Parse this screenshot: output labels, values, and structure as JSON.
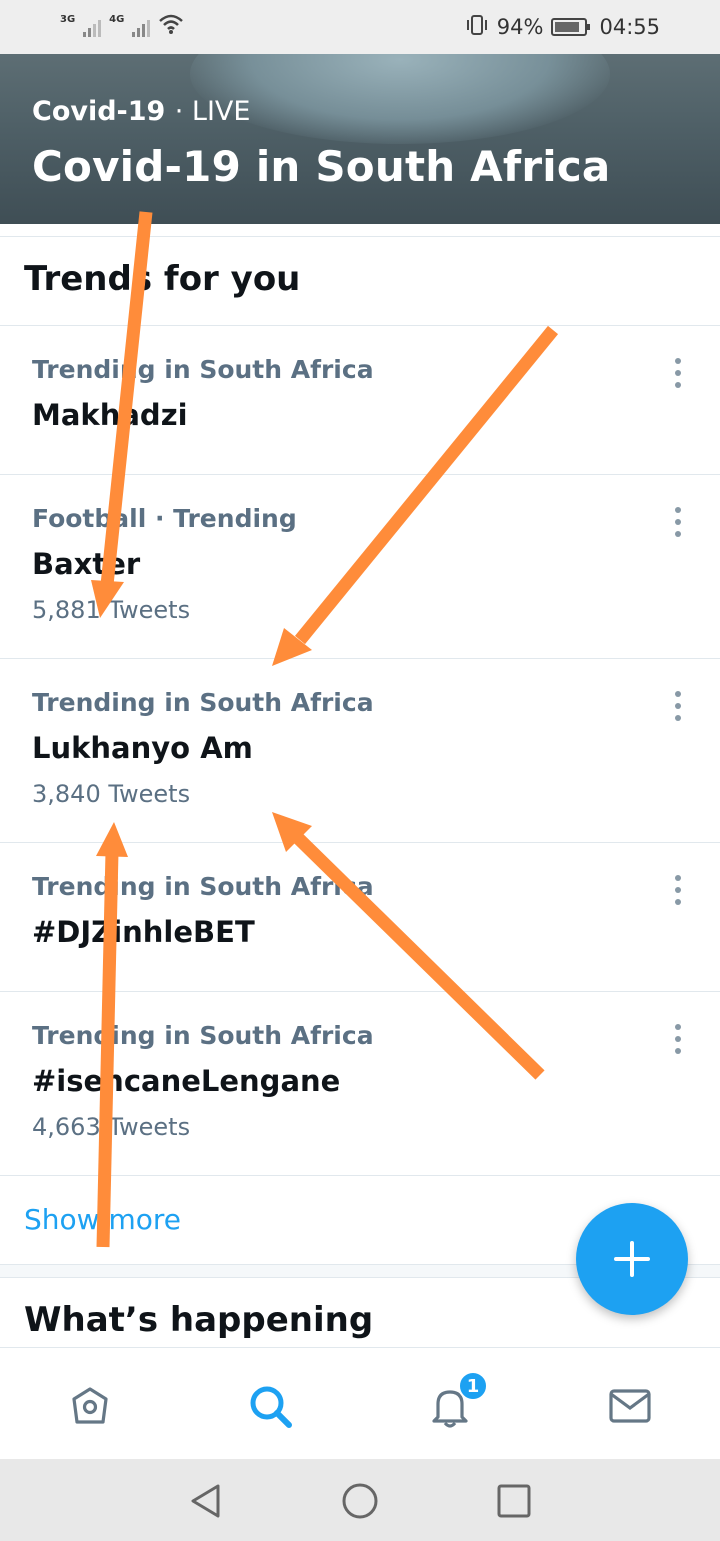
{
  "status_bar": {
    "net1": "3G",
    "net2": "4G",
    "battery": "94%",
    "time": "04:55"
  },
  "hero": {
    "category": "Covid-19",
    "live_label": "· LIVE",
    "title": "Covid-19 in South Africa"
  },
  "trends_header": "Trends for you",
  "trends": [
    {
      "context": "Trending in South Africa",
      "name": "Makhadzi",
      "count": ""
    },
    {
      "context": "Football · Trending",
      "name": "Baxter",
      "count": "5,881 Tweets"
    },
    {
      "context": "Trending in South Africa",
      "name": "Lukhanyo Am",
      "count": "3,840 Tweets"
    },
    {
      "context": "Trending in South Africa",
      "name": "#DJZinhleBET",
      "count": ""
    },
    {
      "context": "Trending in South Africa",
      "name": "#isencaneLengane",
      "count": "4,663 Tweets"
    }
  ],
  "show_more": "Show more",
  "happening_header": "What’s happening",
  "bottom_nav": {
    "notification_count": "1"
  },
  "colors": {
    "accent": "#1da1f2",
    "annotation_arrow": "#ff8c3a",
    "secondary_text": "#5b7083"
  },
  "icons": [
    "home-icon",
    "search-icon",
    "bell-icon",
    "mail-icon",
    "plus-icon",
    "more-vertical-icon",
    "back-icon",
    "home-circle-icon",
    "recents-icon"
  ]
}
